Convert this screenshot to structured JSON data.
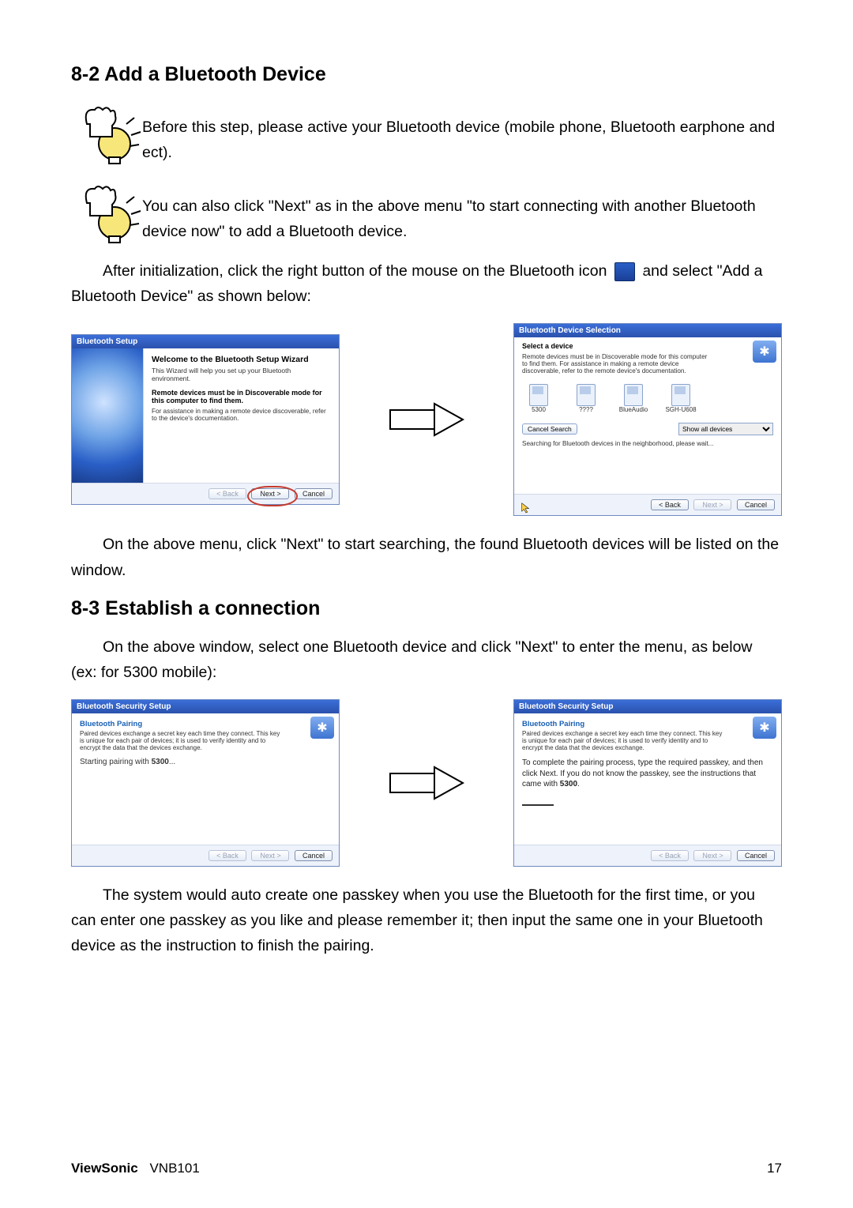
{
  "section1": {
    "title": "8-2 Add a Bluetooth Device",
    "tip1": "Before this step, please active your Bluetooth device (mobile phone, Bluetooth earphone and ect).",
    "tip2": "You can also click \"Next\" as in the above menu \"to start connecting with another Bluetooth device now\" to add a Bluetooth device.",
    "afterInit_pre": "After initialization, click the right button of the mouse on the Bluetooth icon ",
    "afterInit_post": " and select \"Add a Bluetooth Device\" as shown below:"
  },
  "dialog1": {
    "title": "Bluetooth Setup",
    "heading": "Welcome to the Bluetooth Setup Wizard",
    "sub": "This Wizard will help you set up your Bluetooth environment.",
    "bold": "Remote devices must be in Discoverable mode for this computer to find them.",
    "note": "For assistance in making a remote device discoverable, refer to the device's documentation.",
    "back": "< Back",
    "next": "Next >",
    "cancel": "Cancel"
  },
  "dialog2": {
    "title": "Bluetooth Device Selection",
    "selHeading": "Select a device",
    "selNote": "Remote devices must be in Discoverable mode for this computer to find them. For assistance in making a remote device discoverable, refer to the remote device's documentation.",
    "devices": [
      "5300",
      "????",
      "BlueAudio",
      "SGH-U608"
    ],
    "cancelSearch": "Cancel Search",
    "showAll": "Show all devices",
    "status": "Searching for Bluetooth devices in the neighborhood, please wait...",
    "back": "< Back",
    "next": "Next >",
    "cancel": "Cancel"
  },
  "body2": "On the above menu, click \"Next\" to start searching, the found Bluetooth devices will be listed on the window.",
  "section2": {
    "title": "8-3 Establish a connection",
    "intro": "On the above window, select one Bluetooth device and click \"Next\" to enter the menu, as below (ex: for 5300 mobile):"
  },
  "dialog3": {
    "title": "Bluetooth Security Setup",
    "pairTitle": "Bluetooth Pairing",
    "pairSub": "Paired devices exchange a secret key each time they connect. This key is unique for each pair of devices; it is used to verify identity and to encrypt the data that the devices exchange.",
    "start_pre": "Starting pairing with ",
    "start_bold": "5300",
    "start_post": "...",
    "back": "< Back",
    "next": "Next >",
    "cancel": "Cancel"
  },
  "dialog4": {
    "title": "Bluetooth Security Setup",
    "pairTitle": "Bluetooth Pairing",
    "pairSub": "Paired devices exchange a secret key each time they connect. This key is unique for each pair of devices; it is used to verify identity and to encrypt the data that the devices exchange.",
    "complete_pre": "To complete the pairing process, type the required passkey, and then click Next. If you do not know the passkey, see the instructions that came with ",
    "complete_bold": "5300",
    "complete_post": ".",
    "back": "< Back",
    "next": "Next >",
    "cancel": "Cancel"
  },
  "outro": "The system would auto create one passkey when you use the Bluetooth for the first time, or you can enter one passkey as you like and please remember it; then input the same one in your Bluetooth device as the instruction to finish the pairing.",
  "footer": {
    "brand": "ViewSonic",
    "model": "VNB101",
    "page": "17"
  }
}
